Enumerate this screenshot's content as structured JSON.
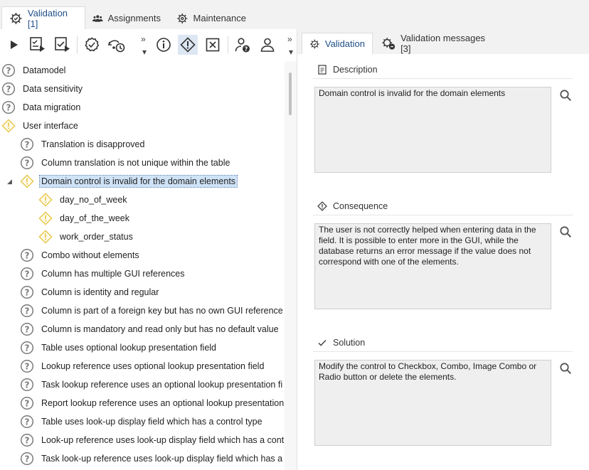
{
  "top_tabs": [
    {
      "label": "Validation [1]",
      "icon": "validation-gear-icon",
      "active": true
    },
    {
      "label": "Assignments",
      "icon": "people-icon",
      "active": false
    },
    {
      "label": "Maintenance",
      "icon": "maintenance-gear-icon",
      "active": false
    }
  ],
  "toolbar": {
    "buttons": [
      "play-icon",
      "execute-list-icon",
      "execute-selected-icon",
      "check-circle-icon",
      "schedule-run-icon",
      "info-icon",
      "warning-diamond-icon",
      "close-box-icon",
      "user-question-icon",
      "user-icon"
    ],
    "more_label": "»"
  },
  "tree": [
    {
      "label": "Datamodel",
      "status": "question",
      "level": 0
    },
    {
      "label": "Data sensitivity",
      "status": "question",
      "level": 0
    },
    {
      "label": "Data migration",
      "status": "question",
      "level": 0
    },
    {
      "label": "User interface",
      "status": "warning",
      "level": 0
    },
    {
      "label": "Translation is disapproved",
      "status": "question",
      "level": 1
    },
    {
      "label": "Column translation is not unique within the table",
      "status": "question",
      "level": 1
    },
    {
      "label": "Domain control is invalid for the domain elements",
      "status": "warning",
      "level": 1,
      "selected": true,
      "expanded": true
    },
    {
      "label": "day_no_of_week",
      "status": "warning",
      "level": 2
    },
    {
      "label": "day_of_the_week",
      "status": "warning",
      "level": 2
    },
    {
      "label": "work_order_status",
      "status": "warning",
      "level": 2
    },
    {
      "label": "Combo without elements",
      "status": "question",
      "level": 1
    },
    {
      "label": "Column has multiple GUI references",
      "status": "question",
      "level": 1
    },
    {
      "label": "Column is identity and regular",
      "status": "question",
      "level": 1
    },
    {
      "label": "Column is part of a foreign key but has no own GUI reference",
      "status": "question",
      "level": 1
    },
    {
      "label": "Column is mandatory and read only but has no default value",
      "status": "question",
      "level": 1
    },
    {
      "label": "Table uses optional lookup presentation field",
      "status": "question",
      "level": 1
    },
    {
      "label": "Lookup reference uses optional lookup presentation field",
      "status": "question",
      "level": 1
    },
    {
      "label": "Task lookup reference uses an optional lookup presentation fi",
      "status": "question",
      "level": 1
    },
    {
      "label": "Report lookup reference uses an optional lookup presentation",
      "status": "question",
      "level": 1
    },
    {
      "label": "Table uses look-up display field which has a control type",
      "status": "question",
      "level": 1
    },
    {
      "label": "Look-up reference uses look-up display field which has a cont",
      "status": "question",
      "level": 1
    },
    {
      "label": "Task look-up reference uses look-up display field which has a",
      "status": "question",
      "level": 1
    }
  ],
  "right_tabs": [
    {
      "label": "Validation",
      "icon": "validation-gear-icon",
      "active": true
    },
    {
      "label": "Validation messages [3]",
      "icon": "messages-gear-icon",
      "active": false
    }
  ],
  "sections": {
    "description": {
      "title": "Description",
      "icon": "document-icon",
      "text": "Domain control is invalid for the domain elements"
    },
    "consequence": {
      "title": "Consequence",
      "icon": "diamond-icon",
      "text": "The user is not correctly helped when entering data in the field. It is possible to enter more in the GUI, while the database returns an error message if the value does not correspond with one of the elements."
    },
    "solution": {
      "title": "Solution",
      "icon": "checkmark-icon",
      "text": "Modify the control to Checkbox, Combo, Image Combo or Radio button or delete the elements."
    }
  },
  "colors": {
    "accent": "#1f4f8a",
    "warning": "#e8c547",
    "question": "#7a7a7a",
    "selection": "#cfe3f7"
  }
}
